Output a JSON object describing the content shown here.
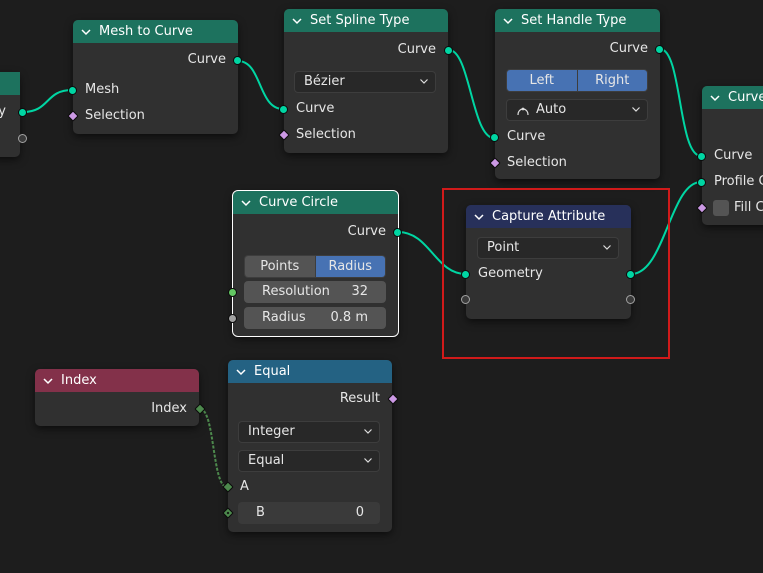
{
  "nodes": {
    "left_partial": {
      "output_label": "ry"
    },
    "mesh_to_curve": {
      "title": "Mesh to Curve",
      "output": "Curve",
      "inputs": [
        "Mesh",
        "Selection"
      ]
    },
    "set_spline_type": {
      "title": "Set Spline Type",
      "output": "Curve",
      "dropdown": "Bézier",
      "inputs": [
        "Curve",
        "Selection"
      ]
    },
    "set_handle_type": {
      "title": "Set Handle Type",
      "output": "Curve",
      "toggle_left": "Left",
      "toggle_right": "Right",
      "dropdown": "Auto",
      "inputs": [
        "Curve",
        "Selection"
      ]
    },
    "curve_to_mesh": {
      "title": "Curve",
      "inputs": [
        "Curve",
        "Profile C",
        "Fill C"
      ]
    },
    "curve_circle": {
      "title": "Curve Circle",
      "output": "Curve",
      "mode_points": "Points",
      "mode_radius": "Radius",
      "resolution_label": "Resolution",
      "resolution_value": "32",
      "radius_label": "Radius",
      "radius_value": "0.8 m"
    },
    "capture_attribute": {
      "title": "Capture Attribute",
      "dropdown": "Point",
      "input": "Geometry"
    },
    "index": {
      "title": "Index",
      "output": "Index"
    },
    "equal": {
      "title": "Equal",
      "output": "Result",
      "data_type": "Integer",
      "operation": "Equal",
      "input_a": "A",
      "input_b_label": "B",
      "input_b_value": "0"
    }
  },
  "colors": {
    "geometry_header": "#1d725e",
    "attribute_header": "#27305a",
    "input_header": "#83314a",
    "converter_header": "#246283",
    "geometry_socket": "#00d6a3",
    "field_socket": "#cc99e5",
    "selection_frame": "#d11a1a"
  }
}
